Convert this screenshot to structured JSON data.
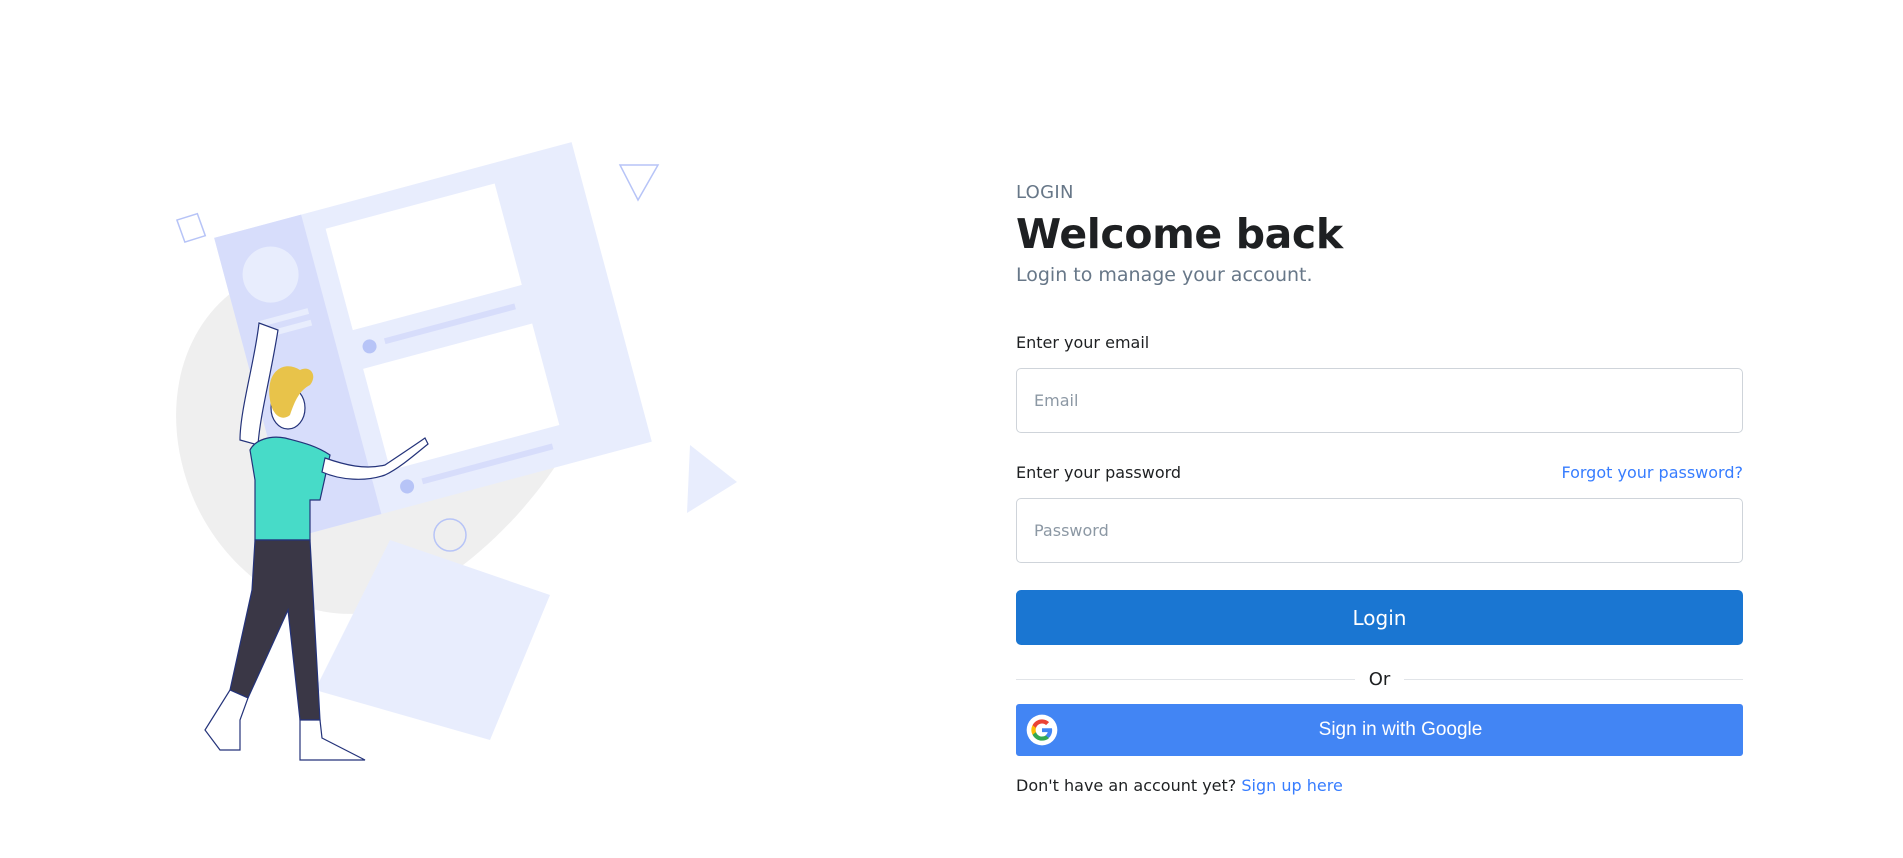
{
  "header": {
    "eyebrow": "LOGIN",
    "title": "Welcome back",
    "subtitle": "Login to manage your account."
  },
  "form": {
    "email_label": "Enter your email",
    "email_placeholder": "Email",
    "password_label": "Enter your password",
    "forgot_link": "Forgot your password?",
    "password_placeholder": "Password",
    "login_button": "Login",
    "divider_text": "Or",
    "google_button": "Sign in with Google",
    "signup_prompt": "Don't have an account yet?",
    "signup_link": "Sign up here"
  },
  "colors": {
    "primary": "#1a76d2",
    "google_blue": "#4285f4",
    "link": "#377dff",
    "muted": "#677788",
    "illustration_accent": "#e8edfd",
    "shirt": "#47dbc8",
    "hair": "#e8c34a",
    "pants": "#3a3746"
  }
}
